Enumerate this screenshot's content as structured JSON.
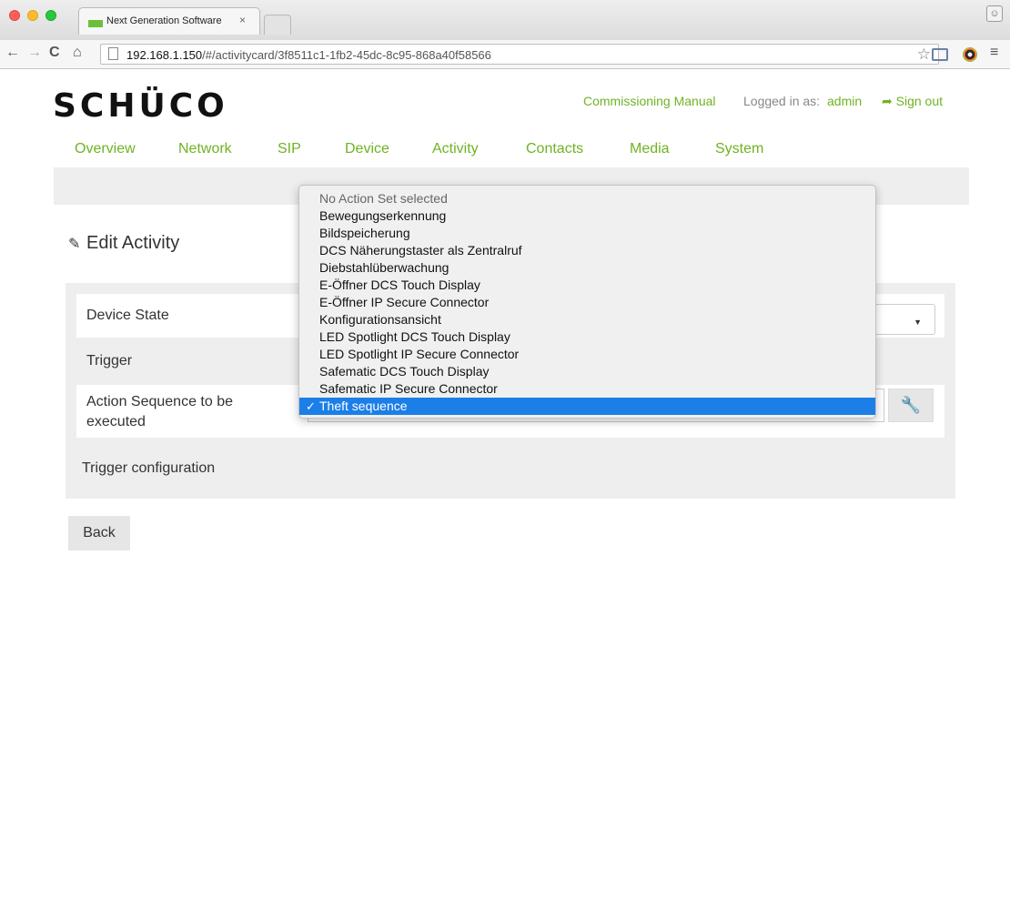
{
  "browser": {
    "tab_title": "Next Generation Software",
    "tab_close": "×",
    "url_host": "192.168.1.150",
    "url_path": "/#/activitycard/3f8511c1-1fb2-45dc-8c95-868a40f58566"
  },
  "header": {
    "logo": "SCHÜCO",
    "manual_link": "Commissioning Manual",
    "logged_in_label": "Logged in as:",
    "user": "admin",
    "signout": "Sign out"
  },
  "nav": {
    "items": [
      "Overview",
      "Network",
      "SIP",
      "Device",
      "Activity",
      "Contacts",
      "Media",
      "System"
    ]
  },
  "page": {
    "title": "Edit Activity"
  },
  "form": {
    "device_state_label": "Device State",
    "trigger_label": "Trigger",
    "action_sequence_label": "Action Sequence to be executed",
    "trigger_config_label": "Trigger configuration",
    "back_label": "Back"
  },
  "dropdown": {
    "options": [
      "No Action Set selected",
      "Bewegungserkennung",
      "Bildspeicherung",
      "DCS Näherungstaster als Zentralruf",
      "Diebstahlüberwachung",
      "E-Öffner DCS Touch Display",
      "E-Öffner IP Secure Connector",
      "Konfigurationsansicht",
      "LED Spotlight DCS Touch Display",
      "LED Spotlight IP Secure Connector",
      "Safematic DCS Touch Display",
      "Safematic IP Secure Connector",
      "Theft sequence"
    ],
    "selected": "Theft sequence",
    "check": "✓"
  },
  "colors": {
    "brand_green": "#6fb324",
    "selection_blue": "#1c7fe8"
  }
}
